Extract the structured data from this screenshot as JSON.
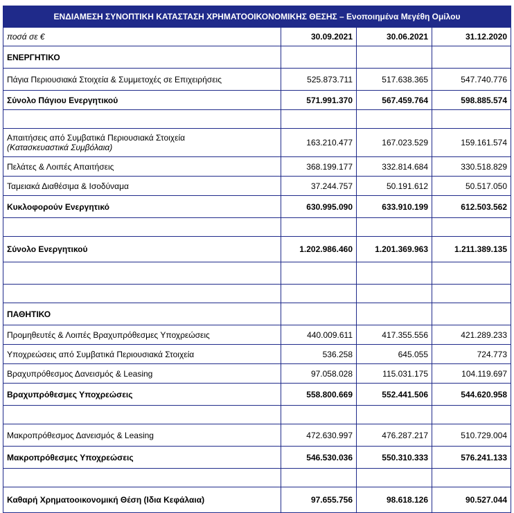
{
  "table": {
    "title": "ΕΝΔΙΑΜΕΣΗ ΣΥΝΟΠΤΙΚΗ ΚΑΤΑΣΤΑΣΗ ΧΡΗΜΑΤΟΟΙΚΟΝΟΜΙΚΗΣ ΘΕΣΗΣ – Ενοποιημένα Μεγέθη Ομίλου",
    "unit_label": "ποσά σε €",
    "columns": [
      "30.09.2021",
      "30.06.2021",
      "31.12.2020"
    ],
    "rows": [
      {
        "label": "ΕΝΕΡΓΗΤΙΚΟ",
        "values": [
          "",
          "",
          ""
        ]
      },
      {
        "label": "Πάγια Περιουσιακά Στοιχεία & Συμμετοχές σε Επιχειρήσεις",
        "values": [
          "525.873.711",
          "517.638.365",
          "547.740.776"
        ]
      },
      {
        "label": "Σύνολο Πάγιου Ενεργητικού",
        "values": [
          "571.991.370",
          "567.459.764",
          "598.885.574"
        ]
      },
      {
        "label": "",
        "values": [
          "",
          "",
          ""
        ]
      },
      {
        "label": "Απαιτήσεις από Συμβατικά Περιουσιακά Στοιχεία",
        "sublabel": "(Κατασκευαστικά Συμβόλαια)",
        "values": [
          "163.210.477",
          "167.023.529",
          "159.161.574"
        ]
      },
      {
        "label": "Πελάτες & Λοιπές Απαιτήσεις",
        "values": [
          "368.199.177",
          "332.814.684",
          "330.518.829"
        ]
      },
      {
        "label": "Ταμειακά Διαθέσιμα & Ισοδύναμα",
        "values": [
          "37.244.757",
          "50.191.612",
          "50.517.050"
        ]
      },
      {
        "label": "Κυκλοφορούν Ενεργητικό",
        "values": [
          "630.995.090",
          "633.910.199",
          "612.503.562"
        ]
      },
      {
        "label": "",
        "values": [
          "",
          "",
          ""
        ]
      },
      {
        "label": "Σύνολο Ενεργητικού",
        "values": [
          "1.202.986.460",
          "1.201.369.963",
          "1.211.389.135"
        ]
      },
      {
        "label": "",
        "values": [
          "",
          "",
          ""
        ]
      },
      {
        "label": "",
        "values": [
          "",
          "",
          ""
        ]
      },
      {
        "label": "ΠΑΘΗΤΙΚΟ",
        "values": [
          "",
          "",
          ""
        ]
      },
      {
        "label": "Προμηθευτές & Λοιπές Βραχυπρόθεσμες Υποχρεώσεις",
        "values": [
          "440.009.611",
          "417.355.556",
          "421.289.233"
        ]
      },
      {
        "label": "Υποχρεώσεις από Συμβατικά Περιουσιακά Στοιχεία",
        "values": [
          "536.258",
          "645.055",
          "724.773"
        ]
      },
      {
        "label": "Βραχυπρόθεσμος Δανεισμός & Leasing",
        "values": [
          "97.058.028",
          "115.031.175",
          "104.119.697"
        ]
      },
      {
        "label": "Βραχυπρόθεσμες Υποχρεώσεις",
        "values": [
          "558.800.669",
          "552.441.506",
          "544.620.958"
        ]
      },
      {
        "label": "",
        "values": [
          "",
          "",
          ""
        ]
      },
      {
        "label": "Μακροπρόθεσμος Δανεισμός & Leasing",
        "values": [
          "472.630.997",
          "476.287.217",
          "510.729.004"
        ]
      },
      {
        "label": "Μακροπρόθεσμες Υποχρεώσεις",
        "values": [
          "546.530.036",
          "550.310.333",
          "576.241.133"
        ]
      },
      {
        "label": "",
        "values": [
          "",
          "",
          ""
        ]
      },
      {
        "label": "Καθαρή Χρηματοοικονομική Θέση (Ιδια Κεφάλαια)",
        "values": [
          "97.655.756",
          "98.618.126",
          "90.527.044"
        ]
      }
    ]
  },
  "colors": {
    "header_bg": "#1f2a8a",
    "header_text": "#ffffff",
    "border": "#1f2a8a"
  }
}
